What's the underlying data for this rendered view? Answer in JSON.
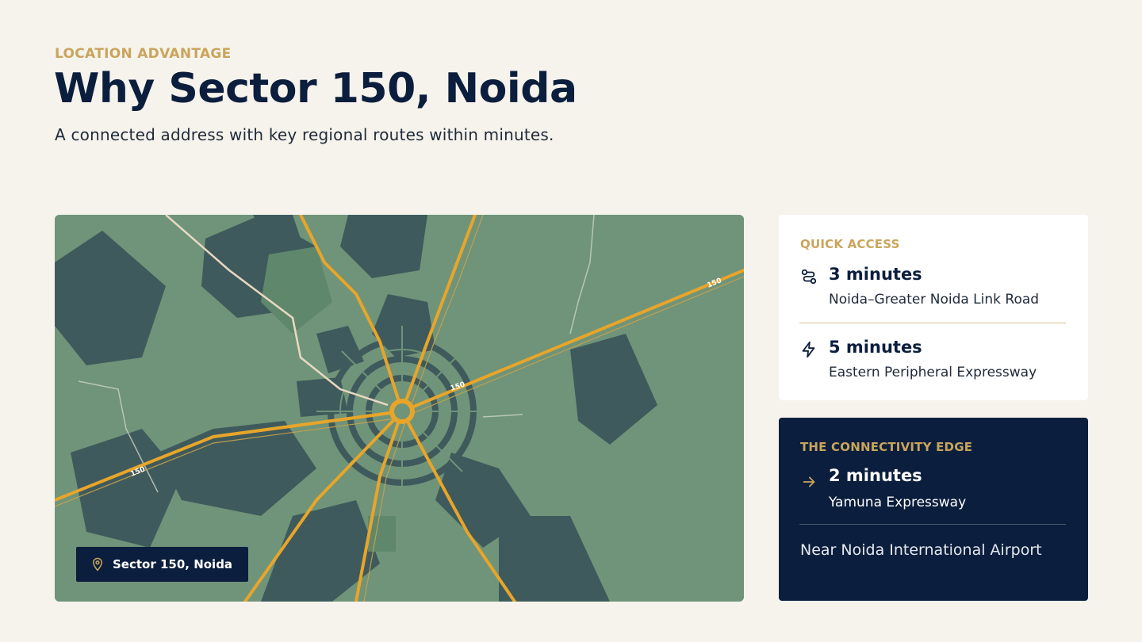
{
  "header": {
    "eyebrow": "LOCATION ADVANTAGE",
    "title": "Why Sector 150, Noida",
    "subtitle": "A connected address with key regional routes within minutes."
  },
  "map": {
    "badge_label": "Sector 150, Noida",
    "road_labels": [
      "150",
      "150",
      "150"
    ],
    "colors": {
      "land": "#6f9479",
      "blocks": "#3f5a5c",
      "roads": "#e8a52a",
      "paths": "#e9d8c2"
    }
  },
  "quick_access": {
    "label": "QUICK ACCESS",
    "items": [
      {
        "icon": "route-icon",
        "title": "3 minutes",
        "subtitle": "Noida–Greater Noida Link Road"
      },
      {
        "icon": "bolt-icon",
        "title": "5 minutes",
        "subtitle": "Eastern Peripheral Expressway"
      }
    ]
  },
  "connectivity_edge": {
    "label": "THE CONNECTIVITY EDGE",
    "item": {
      "icon": "arrow-right-icon",
      "title": "2 minutes",
      "subtitle": "Yamuna Expressway"
    },
    "note": "Near Noida International Airport"
  },
  "colors": {
    "background": "#f6f3ec",
    "navy": "#0b1e3d",
    "gold": "#c9a55c"
  }
}
